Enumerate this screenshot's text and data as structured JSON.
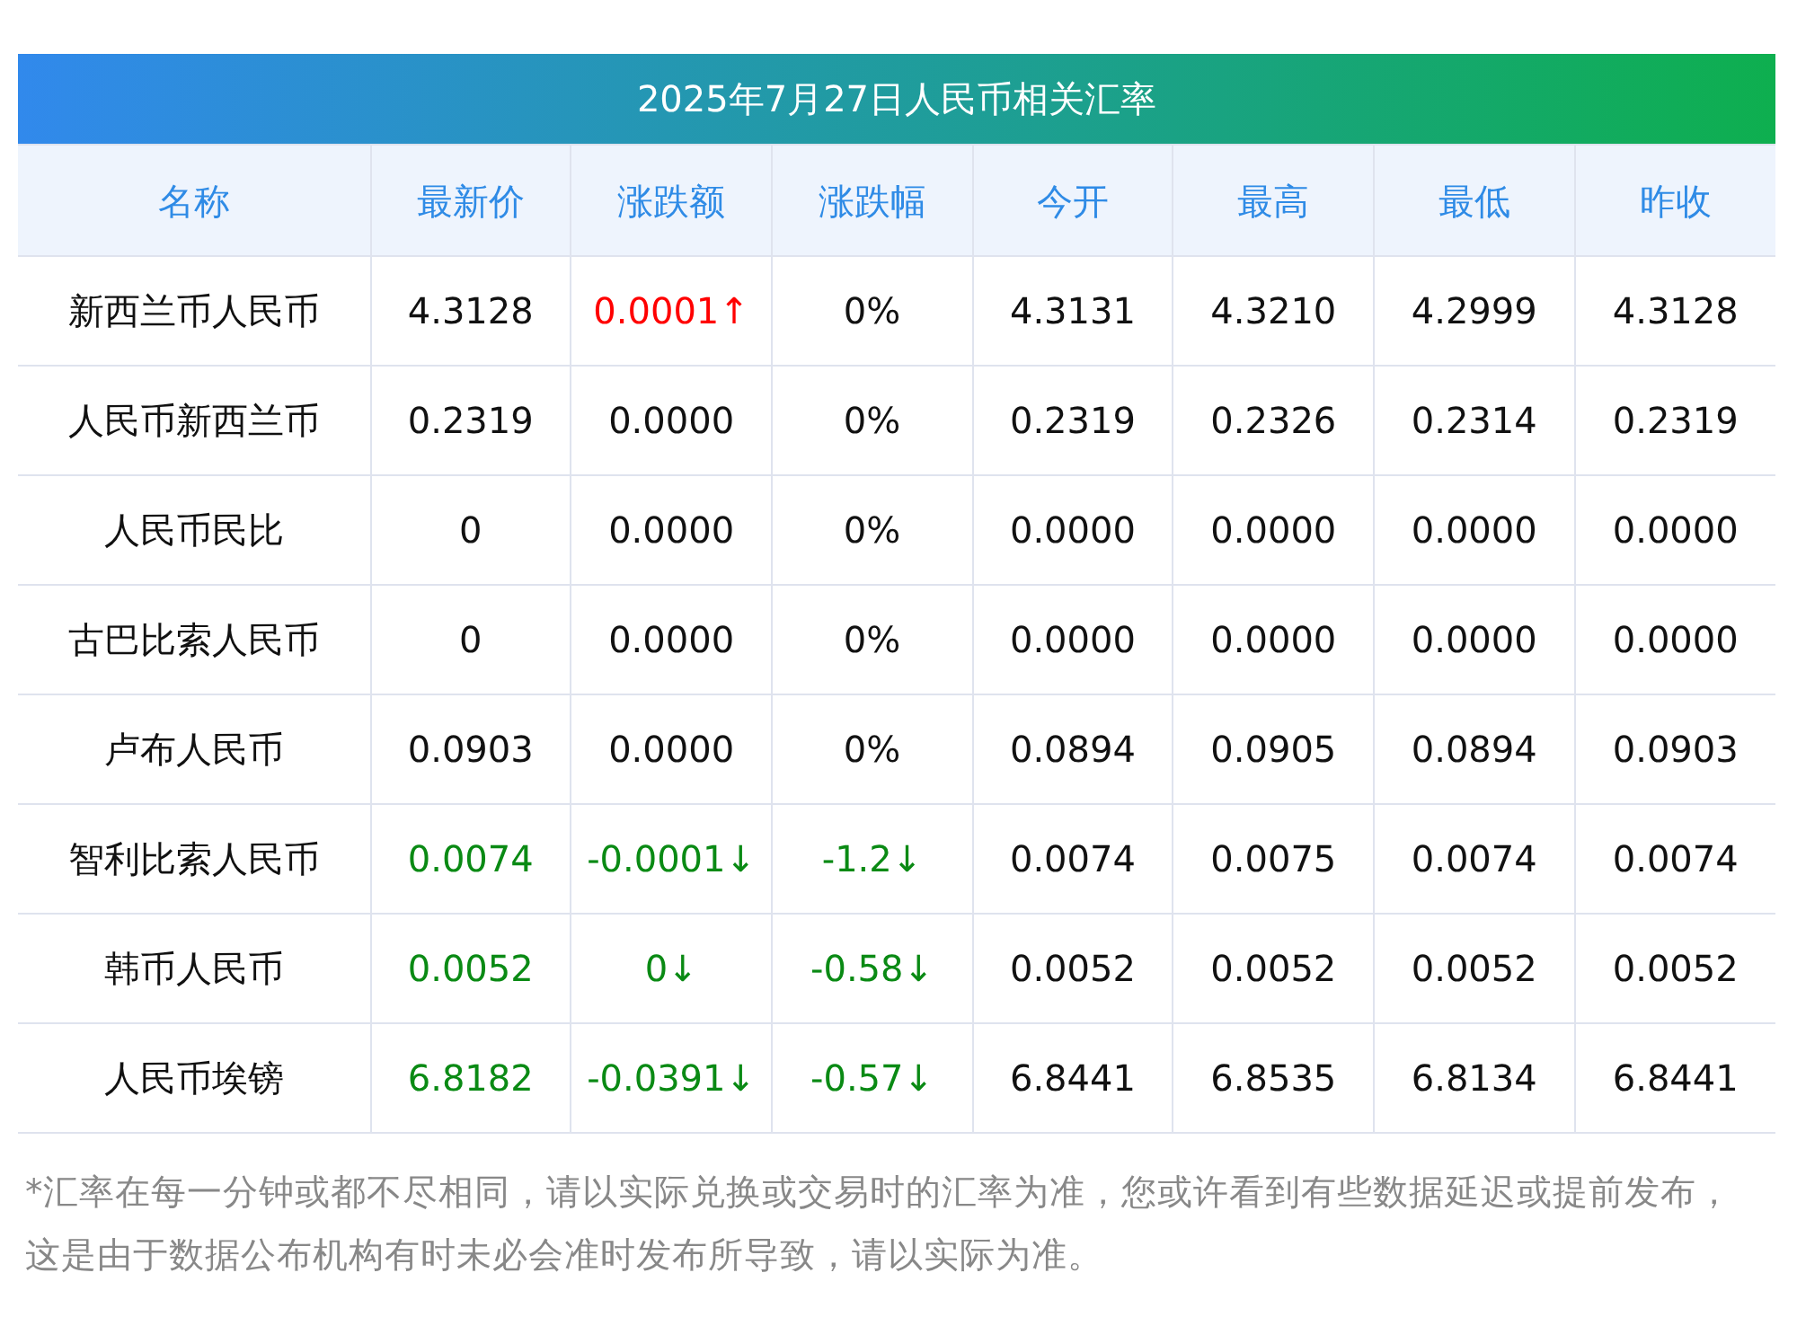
{
  "title": "2025年7月27日人民币相关汇率",
  "columns": [
    "名称",
    "最新价",
    "涨跌额",
    "涨跌幅",
    "今开",
    "最高",
    "最低",
    "昨收"
  ],
  "rows": [
    {
      "cells": [
        {
          "text": "新西兰币人民币",
          "color": "#111111"
        },
        {
          "text": "4.3128",
          "color": "#111111"
        },
        {
          "text": "0.0001↑",
          "color": "#ff0000"
        },
        {
          "text": "0%",
          "color": "#111111"
        },
        {
          "text": "4.3131",
          "color": "#111111"
        },
        {
          "text": "4.3210",
          "color": "#111111"
        },
        {
          "text": "4.2999",
          "color": "#111111"
        },
        {
          "text": "4.3128",
          "color": "#111111"
        }
      ]
    },
    {
      "cells": [
        {
          "text": "人民币新西兰币",
          "color": "#111111"
        },
        {
          "text": "0.2319",
          "color": "#111111"
        },
        {
          "text": "0.0000",
          "color": "#111111"
        },
        {
          "text": "0%",
          "color": "#111111"
        },
        {
          "text": "0.2319",
          "color": "#111111"
        },
        {
          "text": "0.2326",
          "color": "#111111"
        },
        {
          "text": "0.2314",
          "color": "#111111"
        },
        {
          "text": "0.2319",
          "color": "#111111"
        }
      ]
    },
    {
      "cells": [
        {
          "text": "人民币民比",
          "color": "#111111"
        },
        {
          "text": "0",
          "color": "#111111"
        },
        {
          "text": "0.0000",
          "color": "#111111"
        },
        {
          "text": "0%",
          "color": "#111111"
        },
        {
          "text": "0.0000",
          "color": "#111111"
        },
        {
          "text": "0.0000",
          "color": "#111111"
        },
        {
          "text": "0.0000",
          "color": "#111111"
        },
        {
          "text": "0.0000",
          "color": "#111111"
        }
      ]
    },
    {
      "cells": [
        {
          "text": "古巴比索人民币",
          "color": "#111111"
        },
        {
          "text": "0",
          "color": "#111111"
        },
        {
          "text": "0.0000",
          "color": "#111111"
        },
        {
          "text": "0%",
          "color": "#111111"
        },
        {
          "text": "0.0000",
          "color": "#111111"
        },
        {
          "text": "0.0000",
          "color": "#111111"
        },
        {
          "text": "0.0000",
          "color": "#111111"
        },
        {
          "text": "0.0000",
          "color": "#111111"
        }
      ]
    },
    {
      "cells": [
        {
          "text": "卢布人民币",
          "color": "#111111"
        },
        {
          "text": "0.0903",
          "color": "#111111"
        },
        {
          "text": "0.0000",
          "color": "#111111"
        },
        {
          "text": "0%",
          "color": "#111111"
        },
        {
          "text": "0.0894",
          "color": "#111111"
        },
        {
          "text": "0.0905",
          "color": "#111111"
        },
        {
          "text": "0.0894",
          "color": "#111111"
        },
        {
          "text": "0.0903",
          "color": "#111111"
        }
      ]
    },
    {
      "cells": [
        {
          "text": "智利比索人民币",
          "color": "#111111"
        },
        {
          "text": "0.0074",
          "color": "#0a8a14"
        },
        {
          "text": "-0.0001↓",
          "color": "#0a8a14"
        },
        {
          "text": "-1.2↓",
          "color": "#0a8a14"
        },
        {
          "text": "0.0074",
          "color": "#111111"
        },
        {
          "text": "0.0075",
          "color": "#111111"
        },
        {
          "text": "0.0074",
          "color": "#111111"
        },
        {
          "text": "0.0074",
          "color": "#111111"
        }
      ]
    },
    {
      "cells": [
        {
          "text": "韩币人民币",
          "color": "#111111"
        },
        {
          "text": "0.0052",
          "color": "#0a8a14"
        },
        {
          "text": "0↓",
          "color": "#0a8a14"
        },
        {
          "text": "-0.58↓",
          "color": "#0a8a14"
        },
        {
          "text": "0.0052",
          "color": "#111111"
        },
        {
          "text": "0.0052",
          "color": "#111111"
        },
        {
          "text": "0.0052",
          "color": "#111111"
        },
        {
          "text": "0.0052",
          "color": "#111111"
        }
      ]
    },
    {
      "cells": [
        {
          "text": "人民币埃镑",
          "color": "#111111"
        },
        {
          "text": "6.8182",
          "color": "#0a8a14"
        },
        {
          "text": "-0.0391↓",
          "color": "#0a8a14"
        },
        {
          "text": "-0.57↓",
          "color": "#0a8a14"
        },
        {
          "text": "6.8441",
          "color": "#111111"
        },
        {
          "text": "6.8535",
          "color": "#111111"
        },
        {
          "text": "6.8134",
          "color": "#111111"
        },
        {
          "text": "6.8441",
          "color": "#111111"
        }
      ]
    }
  ],
  "note": "*汇率在每一分钟或都不尽相同，请以实际兑换或交易时的汇率为准，您或许看到有些数据延迟或提前发布，这是由于数据公布机构有时未必会准时发布所导致，请以实际为准。"
}
